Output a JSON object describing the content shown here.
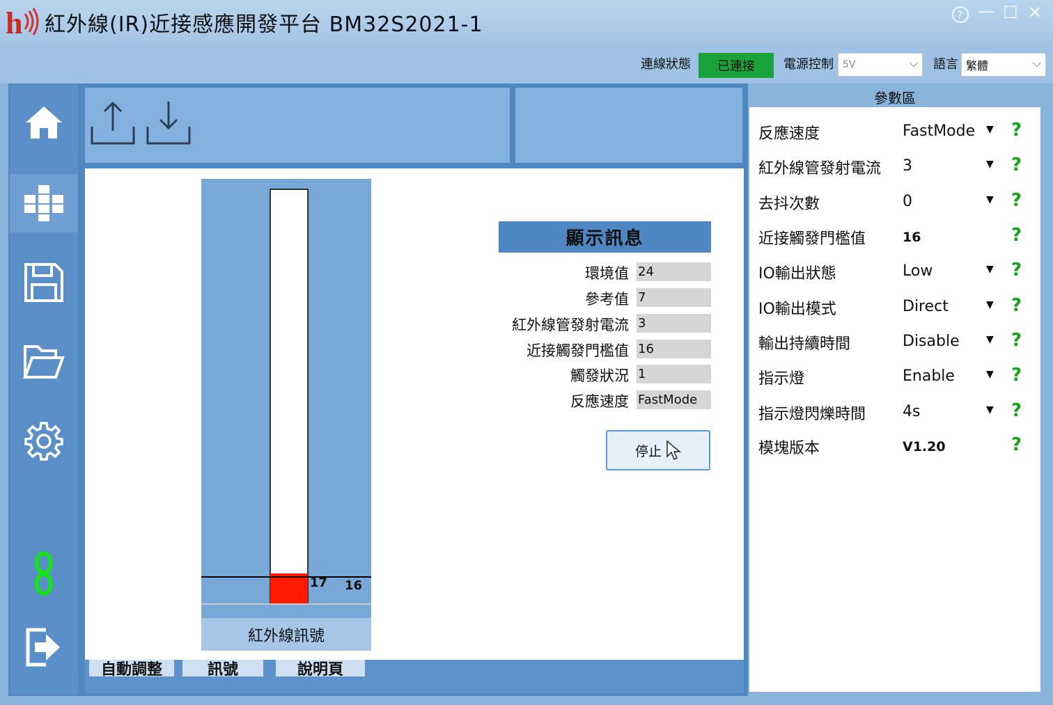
{
  "window": {
    "title": "紅外線(IR)近接感應開發平台 BM32S2021-1",
    "controls": {
      "help": "?",
      "minimize": "—",
      "maximize": "☐",
      "close": "✕"
    }
  },
  "statusbar": {
    "connection_label": "連線狀態",
    "connection_value": "已連接",
    "power_label": "電源控制",
    "power_value": "5V",
    "language_label": "語言",
    "language_value": "繁體"
  },
  "sidebar": {
    "items": [
      {
        "icon": "home-icon"
      },
      {
        "icon": "modules-icon"
      },
      {
        "icon": "save-icon"
      },
      {
        "icon": "folder-open-icon"
      },
      {
        "icon": "gear-icon"
      },
      {
        "icon": "link-icon"
      },
      {
        "icon": "exit-icon"
      }
    ]
  },
  "toolbar": {
    "upload_icon": "upload-icon",
    "download_icon": "download-icon"
  },
  "gauge": {
    "caption": "紅外線訊號",
    "signal_value_label": "17",
    "threshold_label": "16",
    "colors": {
      "fill": "#ff1a00",
      "bg": "#79a8d8"
    }
  },
  "info": {
    "header": "顯示訊息",
    "rows": [
      {
        "label": "環境值",
        "value": "24"
      },
      {
        "label": "參考值",
        "value": "7"
      },
      {
        "label": "紅外線管發射電流",
        "value": "3"
      },
      {
        "label": "近接觸發門檻值",
        "value": "16"
      },
      {
        "label": "觸發狀況",
        "value": "1"
      },
      {
        "label": "反應速度",
        "value": "FastMode"
      }
    ],
    "stop_button": "停止"
  },
  "tabs": [
    {
      "label": "自動調整"
    },
    {
      "label": "訊號"
    },
    {
      "label": "說明頁"
    }
  ],
  "params": {
    "header": "參數區",
    "rows": [
      {
        "label": "反應速度",
        "value": "FastMode"
      },
      {
        "label": "紅外線管發射電流",
        "value": "3"
      },
      {
        "label": "去抖次數",
        "value": "0"
      },
      {
        "label": "近接觸發門檻值",
        "value": "16"
      },
      {
        "label": "IO輸出狀態",
        "value": "Low"
      },
      {
        "label": "IO輸出模式",
        "value": "Direct"
      },
      {
        "label": "輸出持續時間",
        "value": "Disable"
      },
      {
        "label": "指示燈",
        "value": "Enable"
      },
      {
        "label": "指示燈閃爍時間",
        "value": "4s"
      },
      {
        "label": "模塊版本",
        "value": "V1.20"
      }
    ],
    "help_symbol": "?"
  }
}
